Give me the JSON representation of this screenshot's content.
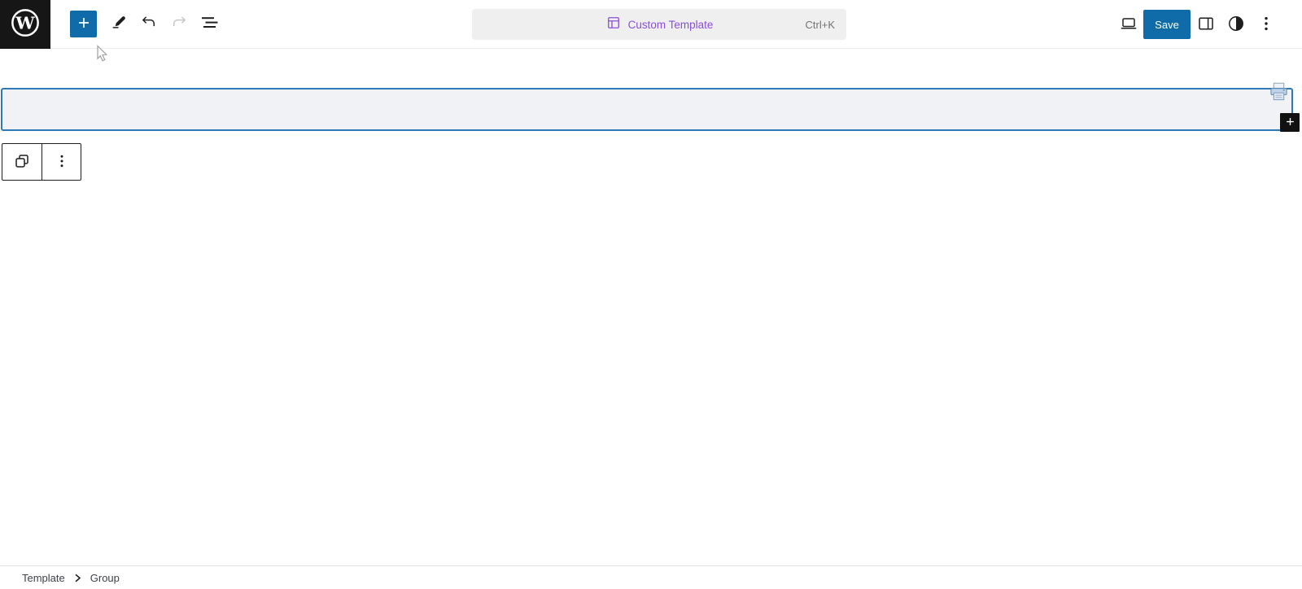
{
  "colors": {
    "accent_blue": "#0f6ca8",
    "selection_border": "#2e79b8",
    "selection_fill": "#f0f2f5",
    "template_purple": "#8a4fd6",
    "command_bar_bg": "#efefef",
    "icon_dark": "#1e1e1e",
    "icon_disabled": "#c6c6c6",
    "shortcut_gray": "#757575",
    "breadcrumb_text": "#3c434a"
  },
  "header": {
    "logo_icon": "wordpress-logo-icon",
    "inserter_icon": "plus-icon",
    "tools": {
      "edit_icon": "pencil-icon",
      "undo_icon": "undo-arrow-icon",
      "redo_icon": "redo-arrow-icon",
      "redo_disabled": true,
      "overview_icon": "list-view-icon"
    },
    "command_bar": {
      "icon": "template-layout-icon",
      "label": "Custom Template",
      "shortcut": "Ctrl+K"
    },
    "right": {
      "view_icon": "laptop-icon",
      "save_label": "Save",
      "settings_icon": "sidebar-panel-icon",
      "styles_icon": "half-circle-icon",
      "more_icon": "kebab-menu-icon"
    }
  },
  "canvas": {
    "selected_block": {
      "type": "Group",
      "state": "selected-empty",
      "drag_ghost_icon": "printer-icon",
      "append_icon": "plus-icon"
    },
    "block_toolbar": {
      "block_icon": "group-blocks-icon",
      "options_icon": "vertical-ellipsis-icon"
    }
  },
  "footer": {
    "breadcrumb": [
      {
        "label": "Template"
      },
      {
        "label": "Group"
      }
    ],
    "separator_icon": "chevron-right-icon"
  }
}
